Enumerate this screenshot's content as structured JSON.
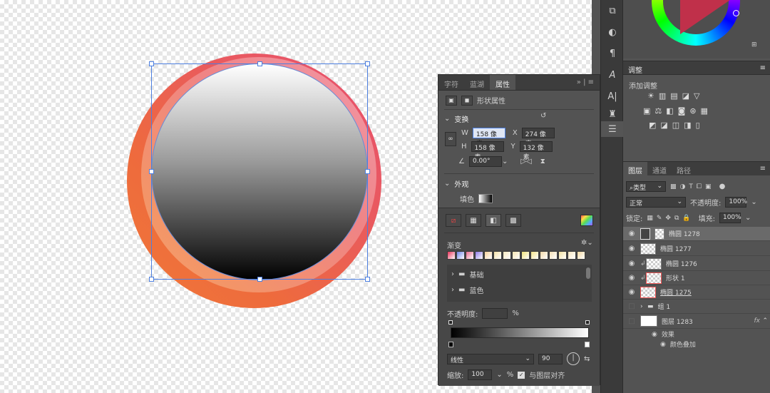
{
  "props_panel": {
    "tabs": [
      "字符",
      "蓝湖",
      "属性"
    ],
    "active_tab": "属性",
    "shape_props_label": "形状属性",
    "transform": {
      "section": "变换",
      "w_label": "W",
      "w_value": "158 像素",
      "x_label": "X",
      "x_value": "274 像素",
      "h_label": "H",
      "h_value": "158 像素",
      "y_label": "Y",
      "y_value": "132 像素",
      "angle_value": "0.00°"
    },
    "appearance": {
      "section": "外观",
      "fill_label": "填色"
    },
    "gradient": {
      "title": "渐变",
      "folders": [
        "基础",
        "蓝色"
      ],
      "opacity_label": "不透明度:",
      "opacity_unit": "%",
      "type_value": "线性",
      "angle_value": "90",
      "scale_label": "缩放:",
      "scale_value": "100",
      "scale_unit": "%",
      "align_label": "与图层对齐",
      "swatch_colors": [
        "#e8345a",
        "#6f84e8",
        "#e86c8f",
        "#8f7ae8",
        "#f6d29a",
        "#f5e3a8",
        "#f7e9bf",
        "#f7e5b0",
        "#efe27a",
        "#f3e38a",
        "#f1d8a8",
        "#f3dfb5",
        "#f4e2a0",
        "#f6e6c0",
        "#f3d9a1"
      ]
    }
  },
  "adjust_panel": {
    "title": "调整",
    "add_label": "添加调整"
  },
  "layers_panel": {
    "tabs": [
      "图层",
      "通道",
      "路径"
    ],
    "filter_kind": "类型",
    "blend_mode": "正常",
    "opacity_label": "不透明度:",
    "opacity_value": "100%",
    "lock_label": "锁定:",
    "fill_label": "填充:",
    "fill_value": "100%",
    "layers": [
      {
        "name": "椭圆 1278"
      },
      {
        "name": "椭圆 1277"
      },
      {
        "name": "椭圆 1276"
      },
      {
        "name": "形状 1"
      },
      {
        "name": "椭圆 1275"
      },
      {
        "name": "组 1"
      },
      {
        "name": "图层 1283",
        "fx": "fx"
      }
    ],
    "effects_label": "效果",
    "color_overlay_label": "颜色叠加"
  },
  "colors": {
    "canvas_ring": "#ee6b3c",
    "selection": "#4c7fe0",
    "panel_bg": "#535353"
  }
}
